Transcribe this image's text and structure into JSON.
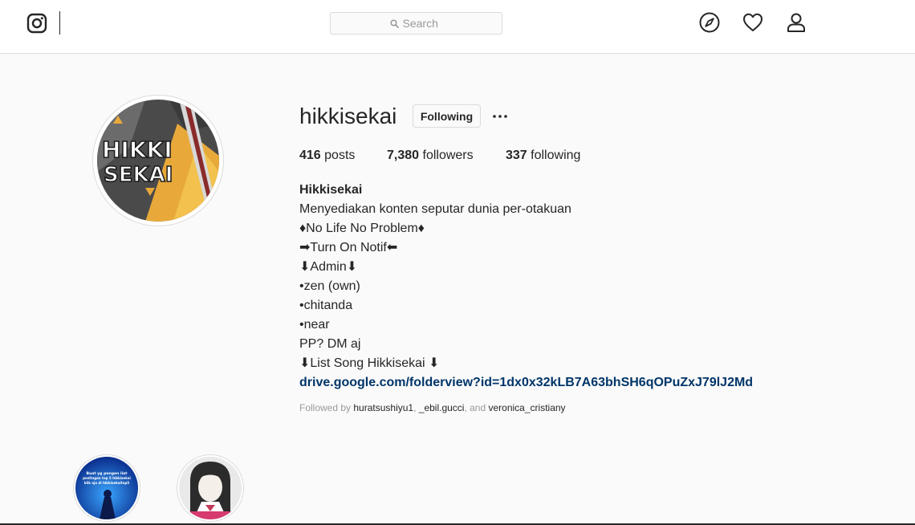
{
  "nav": {
    "search_placeholder": "Search",
    "icons": [
      "instagram-glyph-icon",
      "explore-compass-icon",
      "activity-heart-icon",
      "profile-person-icon"
    ]
  },
  "profile": {
    "username": "hikkisekai",
    "follow_label": "Following",
    "avatar_text_top": "HIKKI",
    "avatar_text_bottom": "SEKAI",
    "stats": {
      "posts_count": "416",
      "posts_label": "posts",
      "followers_count": "7,380",
      "followers_label": "followers",
      "following_count": "337",
      "following_label": "following"
    },
    "bio": {
      "name": "Hikkisekai",
      "lines": [
        "Menyediakan konten seputar dunia per-otakuan",
        "♦No Life No Problem♦",
        "➡Turn On Notif⬅",
        "⬇Admin⬇",
        "•zen (own)",
        "•chitanda",
        "•near",
        "PP? DM aj",
        "⬇List Song Hikkisekai ⬇"
      ],
      "link": "drive.google.com/folderview?id=1dx0x32kLB7A63bhSH6qOPuZxJ79lJ2Md"
    },
    "followed_by": {
      "prefix": "Followed by ",
      "users": [
        "huratsushiyu1",
        "_ebil.gucci",
        "veronica_cristiany"
      ],
      "sep1": ", ",
      "sep2": ", and "
    }
  },
  "highlights": [
    {
      "caption_lines": [
        "Buat yg pengen liat",
        "postingan top 5 hikkisekai",
        "klik aja di hikkisekaitop5"
      ]
    },
    {
      "caption_lines": []
    }
  ],
  "colors": {
    "background": "#fafafa",
    "text": "#262626",
    "muted": "#999999",
    "border": "#dbdbdb",
    "link": "#003569",
    "avatar_orange": "#e8a93a",
    "avatar_gray": "#4a4a4a"
  }
}
